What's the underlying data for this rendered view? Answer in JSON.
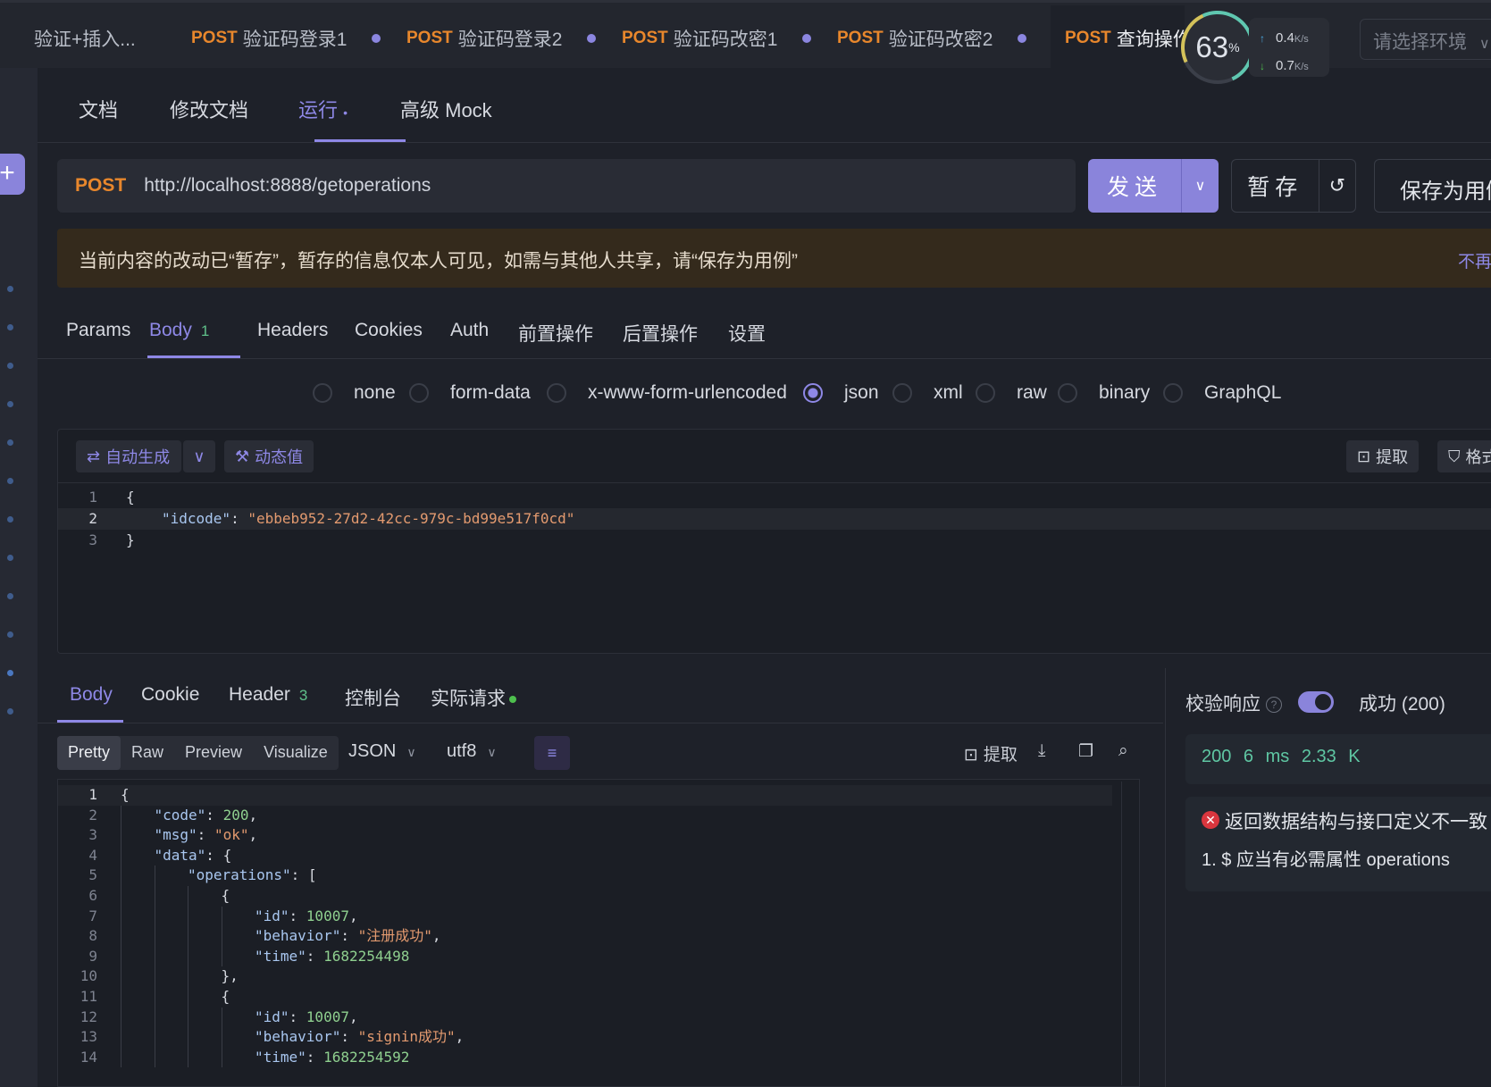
{
  "tabs": {
    "first": "验证+插入...",
    "items": [
      {
        "method": "POST",
        "label": "验证码登录1"
      },
      {
        "method": "POST",
        "label": "验证码登录2"
      },
      {
        "method": "POST",
        "label": "验证码改密1"
      },
      {
        "method": "POST",
        "label": "验证码改密2"
      }
    ],
    "active": {
      "method": "POST",
      "label": "查询操作信息"
    }
  },
  "monitor": {
    "percent": "63",
    "unit": "%",
    "up": "0.4",
    "down": "0.7",
    "rate_unit": "K/s"
  },
  "env_placeholder": "请选择环境",
  "subtabs": [
    "文档",
    "修改文档",
    "运行",
    "高级 Mock"
  ],
  "request": {
    "method": "POST",
    "url": "http://localhost:8888/getoperations",
    "send": "发送",
    "stash": "暂存",
    "save_as": "保存为用例"
  },
  "banner": {
    "text": "当前内容的改动已“暂存”，暂存的信息仅本人可见，如需与其他人共享，请“保存为用例”",
    "dismiss": "不再提示"
  },
  "req_tabs": {
    "items": [
      "Params",
      "Body",
      "Headers",
      "Cookies",
      "Auth",
      "前置操作",
      "后置操作",
      "设置"
    ],
    "body_count": "1"
  },
  "body_types": [
    "none",
    "form-data",
    "x-www-form-urlencoded",
    "json",
    "xml",
    "raw",
    "binary",
    "GraphQL"
  ],
  "editor": {
    "auto_gen": "自动生成",
    "dynamic": "动态值",
    "extract": "提取",
    "format": "格式化",
    "lines": [
      {
        "no": "1",
        "text": "{"
      },
      {
        "no": "2",
        "key": "\"idcode\"",
        "value": "\"ebbeb952-27d2-42cc-979c-bd99e517f0cd\""
      },
      {
        "no": "3",
        "text": "}"
      }
    ]
  },
  "response": {
    "tabs": [
      "Body",
      "Cookie",
      "Header",
      "控制台",
      "实际请求"
    ],
    "header_count": "3",
    "views": [
      "Pretty",
      "Raw",
      "Preview",
      "Visualize"
    ],
    "format": "JSON",
    "encoding": "utf8",
    "extract": "提取",
    "lines": [
      {
        "no": "1",
        "indent": 0,
        "parts": [
          [
            "p",
            "{"
          ]
        ]
      },
      {
        "no": "2",
        "indent": 1,
        "parts": [
          [
            "k",
            "\"code\""
          ],
          [
            "p",
            ": "
          ],
          [
            "n",
            "200"
          ],
          [
            "p",
            ","
          ]
        ]
      },
      {
        "no": "3",
        "indent": 1,
        "parts": [
          [
            "k",
            "\"msg\""
          ],
          [
            "p",
            ": "
          ],
          [
            "s",
            "\"ok\""
          ],
          [
            "p",
            ","
          ]
        ]
      },
      {
        "no": "4",
        "indent": 1,
        "parts": [
          [
            "k",
            "\"data\""
          ],
          [
            "p",
            ": {"
          ]
        ]
      },
      {
        "no": "5",
        "indent": 2,
        "parts": [
          [
            "k",
            "\"operations\""
          ],
          [
            "p",
            ": ["
          ]
        ]
      },
      {
        "no": "6",
        "indent": 3,
        "parts": [
          [
            "p",
            "{"
          ]
        ]
      },
      {
        "no": "7",
        "indent": 4,
        "parts": [
          [
            "k",
            "\"id\""
          ],
          [
            "p",
            ": "
          ],
          [
            "n",
            "10007"
          ],
          [
            "p",
            ","
          ]
        ]
      },
      {
        "no": "8",
        "indent": 4,
        "parts": [
          [
            "k",
            "\"behavior\""
          ],
          [
            "p",
            ": "
          ],
          [
            "s",
            "\"注册成功\""
          ],
          [
            "p",
            ","
          ]
        ]
      },
      {
        "no": "9",
        "indent": 4,
        "parts": [
          [
            "k",
            "\"time\""
          ],
          [
            "p",
            ": "
          ],
          [
            "n",
            "1682254498"
          ]
        ]
      },
      {
        "no": "10",
        "indent": 3,
        "parts": [
          [
            "p",
            "},"
          ]
        ]
      },
      {
        "no": "11",
        "indent": 3,
        "parts": [
          [
            "p",
            "{"
          ]
        ]
      },
      {
        "no": "12",
        "indent": 4,
        "parts": [
          [
            "k",
            "\"id\""
          ],
          [
            "p",
            ": "
          ],
          [
            "n",
            "10007"
          ],
          [
            "p",
            ","
          ]
        ]
      },
      {
        "no": "13",
        "indent": 4,
        "parts": [
          [
            "k",
            "\"behavior\""
          ],
          [
            "p",
            ": "
          ],
          [
            "s",
            "\"signin成功\""
          ],
          [
            "p",
            ","
          ]
        ]
      },
      {
        "no": "14",
        "indent": 4,
        "parts": [
          [
            "k",
            "\"time\""
          ],
          [
            "p",
            ": "
          ],
          [
            "n",
            "1682254592"
          ]
        ]
      }
    ]
  },
  "validation": {
    "title": "校验响应",
    "status": "成功 (200)",
    "stats": "200 6 ms 2.33 K",
    "error_title": "返回数据结构与接口定义不一致",
    "error_detail": "1. $ 应当有必需属性 operations"
  },
  "colors": {
    "accent": "#8e88e6",
    "method": "#e8872c",
    "success": "#5fc7a3",
    "error": "#d9363e"
  }
}
